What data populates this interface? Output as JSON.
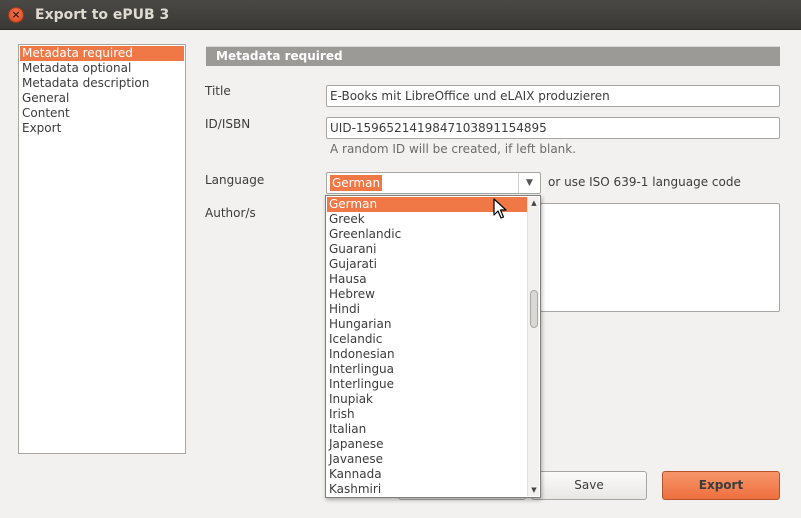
{
  "window": {
    "title": "Export to ePUB 3",
    "close_glyph": "×"
  },
  "sidebar": {
    "items": [
      {
        "label": "Metadata required",
        "selected": true
      },
      {
        "label": "Metadata optional"
      },
      {
        "label": "Metadata description"
      },
      {
        "label": "General"
      },
      {
        "label": "Content"
      },
      {
        "label": "Export"
      }
    ]
  },
  "section": {
    "header": "Metadata required"
  },
  "form": {
    "title_label": "Title",
    "title_value": "E-Books mit LibreOffice und eLAIX produzieren",
    "id_label": "ID/ISBN",
    "id_value": "UID-1596521419847103891154895",
    "id_hint": "A random ID will be created, if left blank.",
    "language_label": "Language",
    "language_selected": "German",
    "language_hint": "or use ISO 639-1 language code",
    "authors_label": "Author/s"
  },
  "language_dropdown": {
    "options": [
      "German",
      "Greek",
      "Greenlandic",
      "Guarani",
      "Gujarati",
      "Hausa",
      "Hebrew",
      "Hindi",
      "Hungarian",
      "Icelandic",
      "Indonesian",
      "Interlingua",
      "Interlingue",
      "Inupiak",
      "Irish",
      "Italian",
      "Japanese",
      "Javanese",
      "Kannada",
      "Kashmiri"
    ],
    "highlighted": "German"
  },
  "buttons": {
    "save": "Save",
    "export": "Export"
  },
  "colors": {
    "accent": "#f07746",
    "titlebar": "#3c3b37"
  },
  "icons": {
    "close": "close-icon",
    "dropdown": "chevron-down-icon",
    "cursor": "mouse-pointer-icon"
  }
}
